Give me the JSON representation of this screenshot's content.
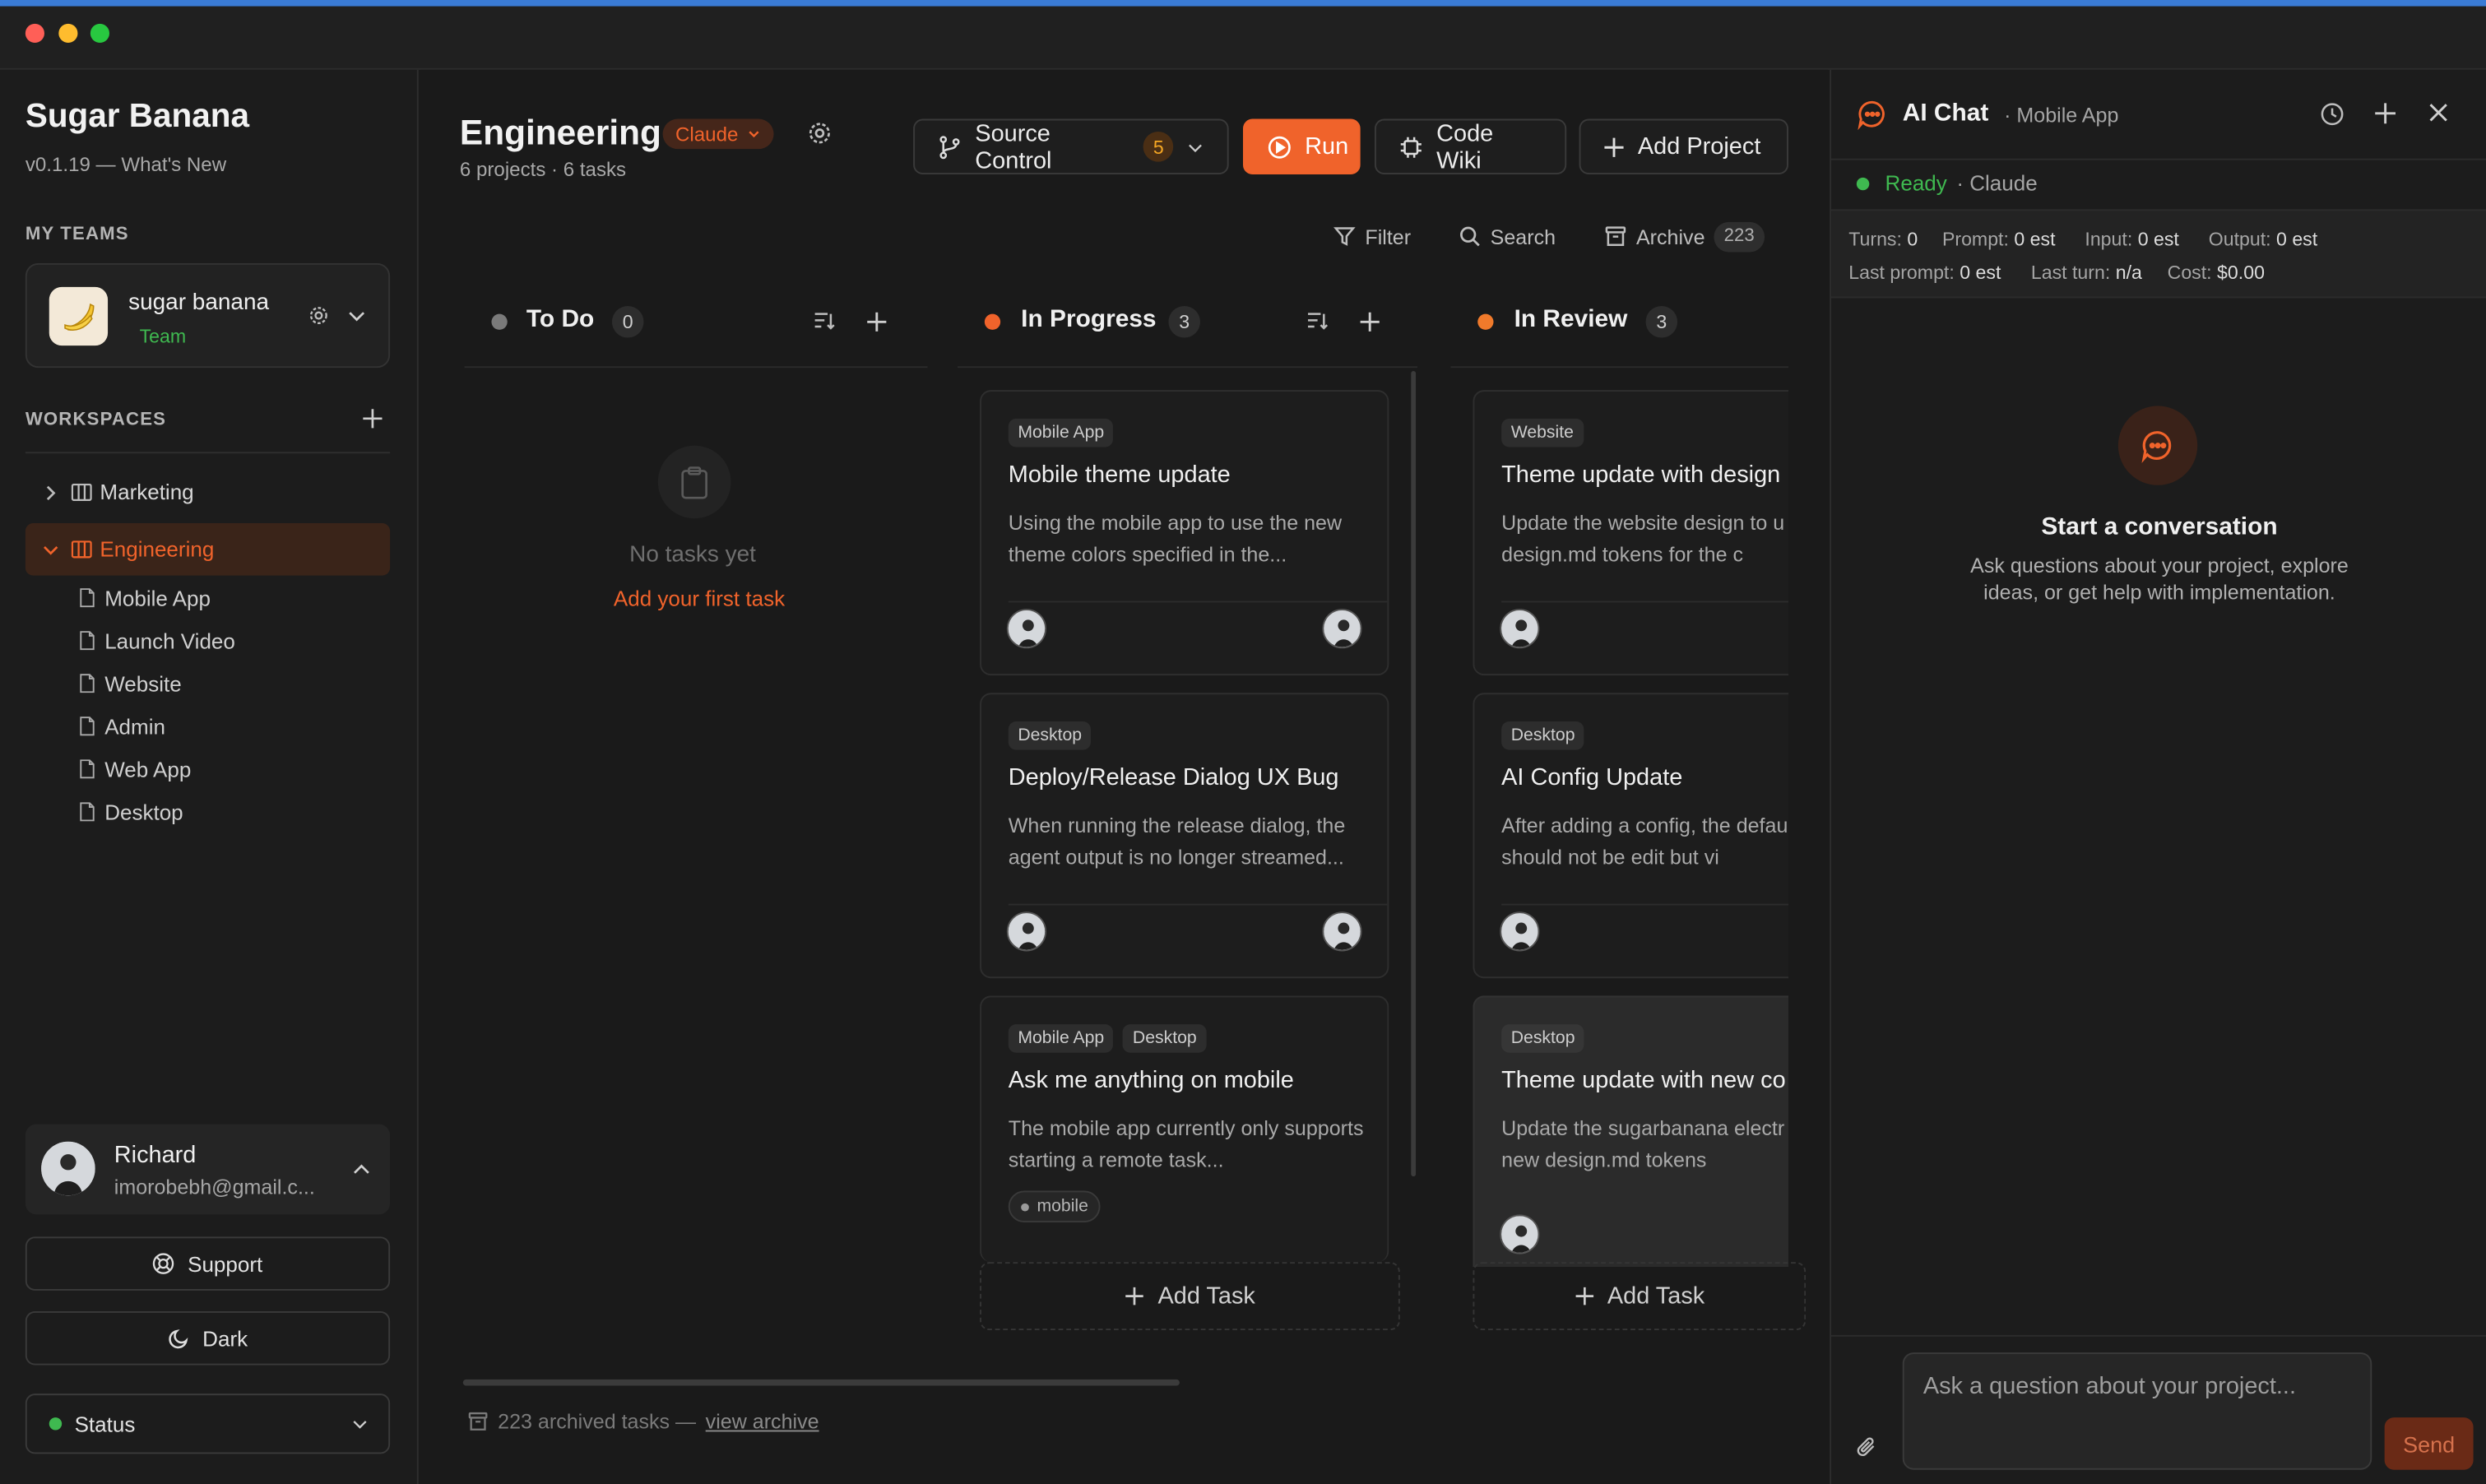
{
  "app": {
    "name": "Sugar Banana",
    "version": "v0.1.19 — What's New"
  },
  "sidebar": {
    "my_teams_label": "MY TEAMS",
    "team": {
      "name": "sugar banana",
      "role": "Team"
    },
    "workspaces_label": "WORKSPACES",
    "workspaces": [
      {
        "label": "Marketing",
        "expanded": false
      },
      {
        "label": "Engineering",
        "expanded": true,
        "active": true
      }
    ],
    "projects": [
      "Mobile App",
      "Launch Video",
      "Website",
      "Admin",
      "Web App",
      "Desktop"
    ],
    "user": {
      "name": "Richard",
      "email": "imorobebh@gmail.c..."
    },
    "support_label": "Support",
    "theme_label": "Dark",
    "status_label": "Status"
  },
  "board": {
    "title": "Engineering",
    "model": "Claude",
    "subtitle": "6 projects · 6 tasks",
    "toolbar": {
      "source_control": "Source Control",
      "source_control_count": "5",
      "run": "Run",
      "code_wiki": "Code Wiki",
      "add_project": "Add Project"
    },
    "filter_label": "Filter",
    "search_label": "Search",
    "archive_label": "Archive",
    "archive_count": "223",
    "columns": [
      {
        "name": "To Do",
        "count": "0",
        "color": "#7a7a7a",
        "empty_title": "No tasks yet",
        "empty_link": "Add your first task",
        "cards": []
      },
      {
        "name": "In Progress",
        "count": "3",
        "color": "#f0632b",
        "add_task": "Add Task",
        "cards": [
          {
            "tags": [
              "Mobile App"
            ],
            "title": "Mobile theme update",
            "desc": "Using the mobile app to use the new theme colors specified in the..."
          },
          {
            "tags": [
              "Desktop"
            ],
            "title": "Deploy/Release Dialog UX Bug",
            "desc": "When running the release dialog, the agent output is no longer streamed..."
          },
          {
            "tags": [
              "Mobile App",
              "Desktop"
            ],
            "title": "Ask me anything on mobile",
            "desc": "The mobile app currently only supports starting a remote task...",
            "label": "mobile"
          }
        ]
      },
      {
        "name": "In Review",
        "count": "3",
        "color": "#f07a2b",
        "add_task": "Add Task",
        "cards": [
          {
            "tags": [
              "Website"
            ],
            "title": "Theme update with design",
            "desc": "Update the website design to u new design.md tokens for the c"
          },
          {
            "tags": [
              "Desktop"
            ],
            "title": "AI Config Update",
            "desc": "After adding a config, the defau button should not be edit but vi"
          },
          {
            "tags": [
              "Desktop"
            ],
            "title": "Theme update with new co",
            "desc": "Update the sugarbanana electr with the new design.md tokens"
          }
        ]
      }
    ],
    "archived_text": "223 archived tasks —",
    "archived_link": "view archive"
  },
  "chat": {
    "title": "AI Chat",
    "context": "· Mobile App",
    "status": "Ready",
    "model": "· Claude",
    "stats": [
      {
        "label": "Turns:",
        "value": "0"
      },
      {
        "label": "Prompt:",
        "value": "0 est"
      },
      {
        "label": "Input:",
        "value": "0 est"
      },
      {
        "label": "Output:",
        "value": "0 est"
      },
      {
        "label": "Last prompt:",
        "value": "0 est"
      },
      {
        "label": "Last turn:",
        "value": "n/a"
      },
      {
        "label": "Cost:",
        "value": "$0.00"
      }
    ],
    "empty_title": "Start a conversation",
    "empty_sub": "Ask questions about your project, explore ideas, or get help with implementation.",
    "input_placeholder": "Ask a question about your project...",
    "send_label": "Send"
  },
  "colors": {
    "accent": "#f0632b",
    "success": "#3fb950",
    "bg": "#1a1a1a"
  }
}
